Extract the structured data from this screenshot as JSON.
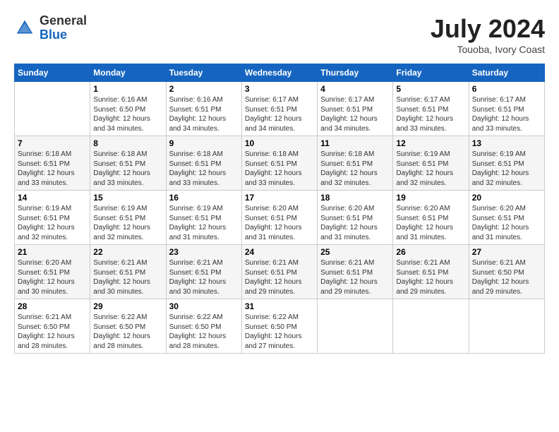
{
  "header": {
    "logo_general": "General",
    "logo_blue": "Blue",
    "month_title": "July 2024",
    "location": "Touoba, Ivory Coast"
  },
  "days_of_week": [
    "Sunday",
    "Monday",
    "Tuesday",
    "Wednesday",
    "Thursday",
    "Friday",
    "Saturday"
  ],
  "weeks": [
    [
      {
        "day": "",
        "info": ""
      },
      {
        "day": "1",
        "info": "Sunrise: 6:16 AM\nSunset: 6:50 PM\nDaylight: 12 hours\nand 34 minutes."
      },
      {
        "day": "2",
        "info": "Sunrise: 6:16 AM\nSunset: 6:51 PM\nDaylight: 12 hours\nand 34 minutes."
      },
      {
        "day": "3",
        "info": "Sunrise: 6:17 AM\nSunset: 6:51 PM\nDaylight: 12 hours\nand 34 minutes."
      },
      {
        "day": "4",
        "info": "Sunrise: 6:17 AM\nSunset: 6:51 PM\nDaylight: 12 hours\nand 34 minutes."
      },
      {
        "day": "5",
        "info": "Sunrise: 6:17 AM\nSunset: 6:51 PM\nDaylight: 12 hours\nand 33 minutes."
      },
      {
        "day": "6",
        "info": "Sunrise: 6:17 AM\nSunset: 6:51 PM\nDaylight: 12 hours\nand 33 minutes."
      }
    ],
    [
      {
        "day": "7",
        "info": "Sunrise: 6:18 AM\nSunset: 6:51 PM\nDaylight: 12 hours\nand 33 minutes."
      },
      {
        "day": "8",
        "info": "Sunrise: 6:18 AM\nSunset: 6:51 PM\nDaylight: 12 hours\nand 33 minutes."
      },
      {
        "day": "9",
        "info": "Sunrise: 6:18 AM\nSunset: 6:51 PM\nDaylight: 12 hours\nand 33 minutes."
      },
      {
        "day": "10",
        "info": "Sunrise: 6:18 AM\nSunset: 6:51 PM\nDaylight: 12 hours\nand 33 minutes."
      },
      {
        "day": "11",
        "info": "Sunrise: 6:18 AM\nSunset: 6:51 PM\nDaylight: 12 hours\nand 32 minutes."
      },
      {
        "day": "12",
        "info": "Sunrise: 6:19 AM\nSunset: 6:51 PM\nDaylight: 12 hours\nand 32 minutes."
      },
      {
        "day": "13",
        "info": "Sunrise: 6:19 AM\nSunset: 6:51 PM\nDaylight: 12 hours\nand 32 minutes."
      }
    ],
    [
      {
        "day": "14",
        "info": "Sunrise: 6:19 AM\nSunset: 6:51 PM\nDaylight: 12 hours\nand 32 minutes."
      },
      {
        "day": "15",
        "info": "Sunrise: 6:19 AM\nSunset: 6:51 PM\nDaylight: 12 hours\nand 32 minutes."
      },
      {
        "day": "16",
        "info": "Sunrise: 6:19 AM\nSunset: 6:51 PM\nDaylight: 12 hours\nand 31 minutes."
      },
      {
        "day": "17",
        "info": "Sunrise: 6:20 AM\nSunset: 6:51 PM\nDaylight: 12 hours\nand 31 minutes."
      },
      {
        "day": "18",
        "info": "Sunrise: 6:20 AM\nSunset: 6:51 PM\nDaylight: 12 hours\nand 31 minutes."
      },
      {
        "day": "19",
        "info": "Sunrise: 6:20 AM\nSunset: 6:51 PM\nDaylight: 12 hours\nand 31 minutes."
      },
      {
        "day": "20",
        "info": "Sunrise: 6:20 AM\nSunset: 6:51 PM\nDaylight: 12 hours\nand 31 minutes."
      }
    ],
    [
      {
        "day": "21",
        "info": "Sunrise: 6:20 AM\nSunset: 6:51 PM\nDaylight: 12 hours\nand 30 minutes."
      },
      {
        "day": "22",
        "info": "Sunrise: 6:21 AM\nSunset: 6:51 PM\nDaylight: 12 hours\nand 30 minutes."
      },
      {
        "day": "23",
        "info": "Sunrise: 6:21 AM\nSunset: 6:51 PM\nDaylight: 12 hours\nand 30 minutes."
      },
      {
        "day": "24",
        "info": "Sunrise: 6:21 AM\nSunset: 6:51 PM\nDaylight: 12 hours\nand 29 minutes."
      },
      {
        "day": "25",
        "info": "Sunrise: 6:21 AM\nSunset: 6:51 PM\nDaylight: 12 hours\nand 29 minutes."
      },
      {
        "day": "26",
        "info": "Sunrise: 6:21 AM\nSunset: 6:51 PM\nDaylight: 12 hours\nand 29 minutes."
      },
      {
        "day": "27",
        "info": "Sunrise: 6:21 AM\nSunset: 6:50 PM\nDaylight: 12 hours\nand 29 minutes."
      }
    ],
    [
      {
        "day": "28",
        "info": "Sunrise: 6:21 AM\nSunset: 6:50 PM\nDaylight: 12 hours\nand 28 minutes."
      },
      {
        "day": "29",
        "info": "Sunrise: 6:22 AM\nSunset: 6:50 PM\nDaylight: 12 hours\nand 28 minutes."
      },
      {
        "day": "30",
        "info": "Sunrise: 6:22 AM\nSunset: 6:50 PM\nDaylight: 12 hours\nand 28 minutes."
      },
      {
        "day": "31",
        "info": "Sunrise: 6:22 AM\nSunset: 6:50 PM\nDaylight: 12 hours\nand 27 minutes."
      },
      {
        "day": "",
        "info": ""
      },
      {
        "day": "",
        "info": ""
      },
      {
        "day": "",
        "info": ""
      }
    ]
  ]
}
